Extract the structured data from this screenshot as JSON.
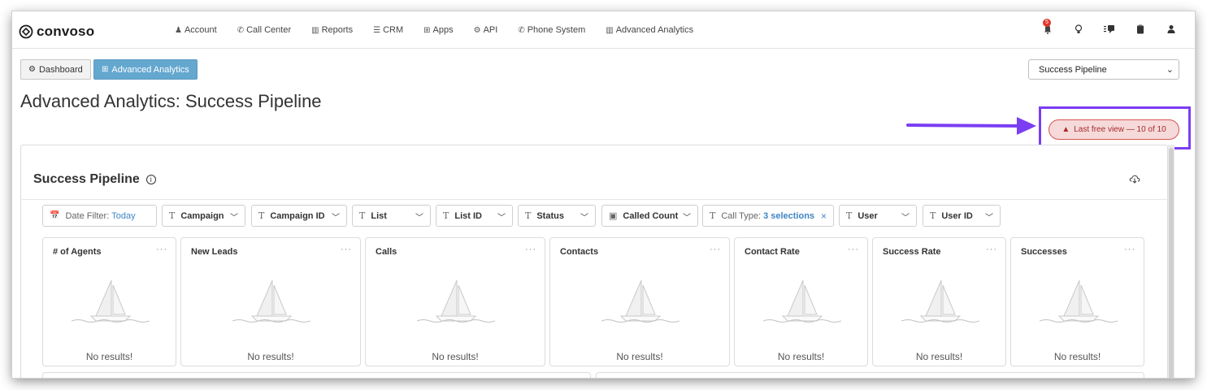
{
  "app": {
    "logo_text": "convoso"
  },
  "nav": {
    "items": [
      {
        "icon": "user-icon",
        "glyph": "♟",
        "label": "Account"
      },
      {
        "icon": "phone-icon",
        "glyph": "✆",
        "label": "Call Center"
      },
      {
        "icon": "bar-chart-icon",
        "glyph": "▥",
        "label": "Reports"
      },
      {
        "icon": "list-icon",
        "glyph": "☰",
        "label": "CRM"
      },
      {
        "icon": "grid-icon",
        "glyph": "⊞",
        "label": "Apps"
      },
      {
        "icon": "gear-icon",
        "glyph": "⚙",
        "label": "API"
      },
      {
        "icon": "phone-icon",
        "glyph": "✆",
        "label": "Phone System"
      },
      {
        "icon": "bar-chart-icon",
        "glyph": "▥",
        "label": "Advanced Analytics"
      }
    ],
    "notification_count": "5"
  },
  "toolbar": {
    "dashboard_label": "Dashboard",
    "advanced_label": "Advanced Analytics",
    "view_select_value": "Success Pipeline"
  },
  "page": {
    "title": "Advanced Analytics: Success Pipeline"
  },
  "notice": {
    "label": "Last free view — 10 of 10",
    "accent": "#7b3ef2",
    "badge_color": "#d9534f"
  },
  "dashboard": {
    "title": "Success Pipeline",
    "filters": [
      {
        "label": "Date Filter:",
        "value": "Today"
      },
      {
        "label": "Campaign"
      },
      {
        "label": "Campaign ID"
      },
      {
        "label": "List"
      },
      {
        "label": "List ID"
      },
      {
        "label": "Status"
      },
      {
        "label": "Called Count"
      },
      {
        "label": "Call Type:",
        "value": "3 selections"
      },
      {
        "label": "User"
      },
      {
        "label": "User ID"
      }
    ],
    "metrics": [
      {
        "title": "# of Agents",
        "empty": "No results!"
      },
      {
        "title": "New Leads",
        "empty": "No results!"
      },
      {
        "title": "Calls",
        "empty": "No results!"
      },
      {
        "title": "Contacts",
        "empty": "No results!"
      },
      {
        "title": "Contact Rate",
        "empty": "No results!"
      },
      {
        "title": "Success Rate",
        "empty": "No results!"
      },
      {
        "title": "Successes",
        "empty": "No results!"
      }
    ],
    "menu_glyph": "···"
  }
}
